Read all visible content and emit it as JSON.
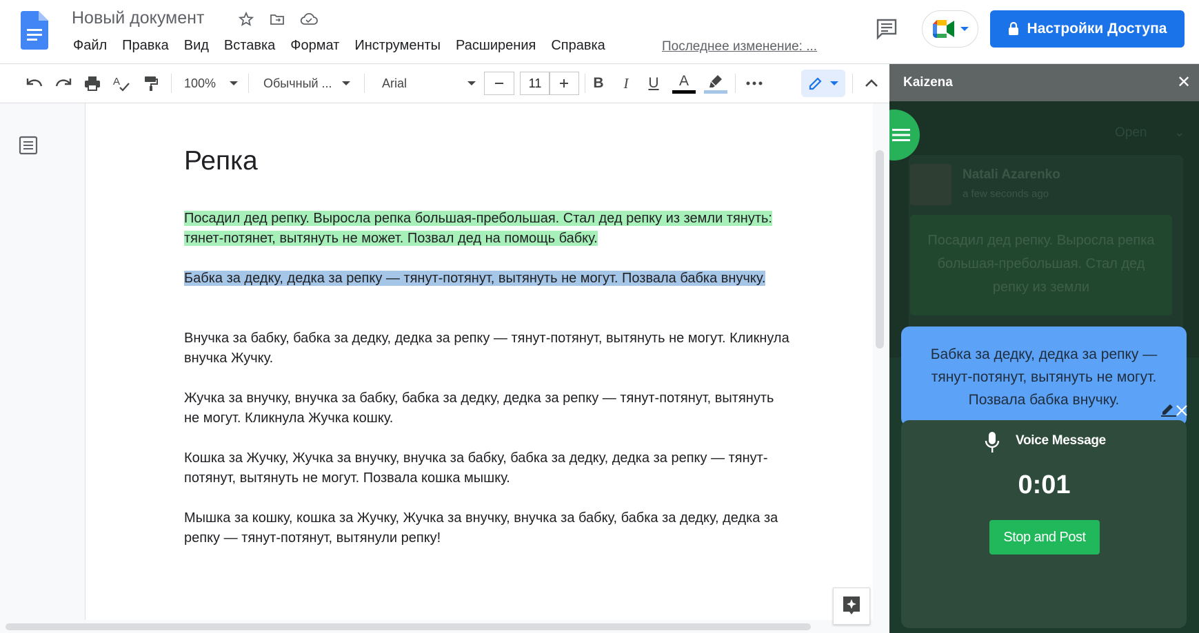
{
  "header": {
    "doc_title": "Новый документ",
    "menu": [
      "Файл",
      "Правка",
      "Вид",
      "Вставка",
      "Формат",
      "Инструменты",
      "Расширения",
      "Справка"
    ],
    "last_edit": "Последнее изменение: ...",
    "share_label": "Настройки Доступа",
    "icons": [
      "docs-logo-icon",
      "star-icon",
      "move-to-folder-icon",
      "cloud-status-icon",
      "comments-icon",
      "google-meet-icon",
      "lock-icon"
    ]
  },
  "toolbar": {
    "zoom": "100%",
    "style": "Обычный ...",
    "font": "Arial",
    "font_size": "11",
    "bold": "B",
    "italic": "I",
    "underline": "U",
    "text_color_letter": "A",
    "text_color": "#000000",
    "highlight_color": "#a6c6e8",
    "icons": [
      "undo-icon",
      "redo-icon",
      "print-icon",
      "spellcheck-icon",
      "paint-format-icon",
      "minus-icon",
      "plus-icon",
      "highlighter-icon",
      "more-icon",
      "edit-pencil-icon",
      "collapse-chevron-icon"
    ]
  },
  "document": {
    "heading": "Репка",
    "paragraphs": [
      "Посадил дед репку. Выросла репка большая-пребольшая. Стал дед репку из земли тянуть: тянет-потянет, вытянуть не может. Позвал дед на помощь бабку.",
      "Бабка за дедку, дедка за репку — тянут-потянут, вытянуть не могут. Позвала бабка внучку.",
      "Внучка за бабку, бабка за дедку, дедка за репку — тянут-потянут, вытянуть не могут. Кликнула внучка Жучку.",
      "Жучка за внучку, внучка за бабку, бабка за дедку, дедка за репку — тянут-потянут, вытянуть не могут. Кликнула Жучка кошку.",
      "Кошка за Жучку, Жучка за внучку, внучка за бабку, бабка за дедку, дедка за репку — тянут-потянут, вытянуть не могут. Позвала кошка мышку.",
      "Мышка за кошку, кошка за Жучку, Жучка за внучку, внучка за бабку, бабка за дедку, дедка за репку — тянут-потянут, вытянули репку!"
    ],
    "highlight_green": "#a8f0b9",
    "highlight_blue": "#a6c6e8"
  },
  "kaizena": {
    "title": "Kaizena",
    "open_label": "Open",
    "author": "Natali Azarenko",
    "time": "a few seconds ago",
    "ghost_quote": "Посадил дед репку. Выросла репка большая-пребольшая. Стал дед репку из земли",
    "quote": "Бабка за дедку, дедка за репку — тянут-потянут, вытянуть не могут. Позвала бабка внучку.",
    "voice_label": "Voice Message",
    "timer": "0:01",
    "stop_label": "Stop and Post"
  }
}
